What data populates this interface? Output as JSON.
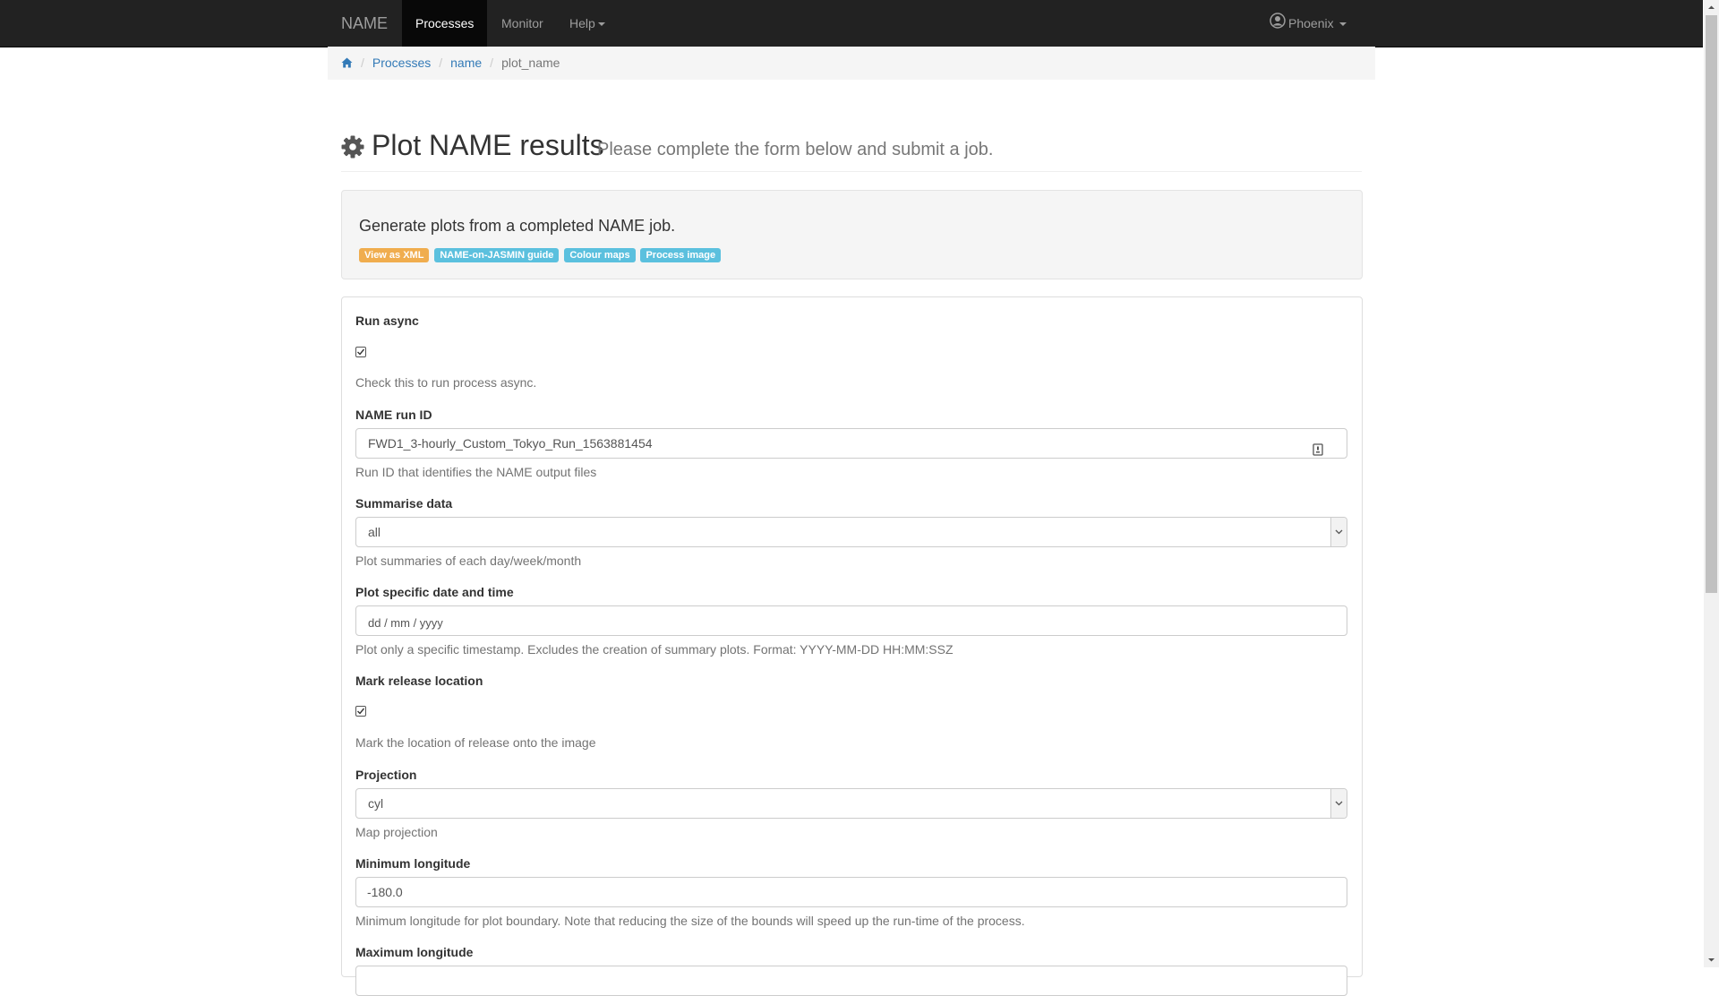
{
  "navbar": {
    "brand": "NAME",
    "items": [
      {
        "label": "Processes",
        "active": true
      },
      {
        "label": "Monitor",
        "active": false
      },
      {
        "label": "Help",
        "active": false
      }
    ],
    "user": "Phoenix"
  },
  "breadcrumb": {
    "items": [
      "Processes",
      "name",
      "plot_name"
    ]
  },
  "header": {
    "title": "Plot NAME results",
    "subtitle": "Please complete the form below and submit a job."
  },
  "well": {
    "description": "Generate plots from a completed NAME job.",
    "labels": [
      {
        "text": "View as XML",
        "color": "#f0ad4e"
      },
      {
        "text": "NAME-on-JASMIN guide",
        "color": "#5bc0de"
      },
      {
        "text": "Colour maps",
        "color": "#5bc0de"
      },
      {
        "text": "Process image",
        "color": "#5bc0de"
      }
    ]
  },
  "form": {
    "run_async": {
      "label": "Run async",
      "checked": true,
      "help": "Check this to run process async."
    },
    "run_id": {
      "label": "NAME run ID",
      "value": "FWD1_3-hourly_Custom_Tokyo_Run_1563881454",
      "help": "Run ID that identifies the NAME output files"
    },
    "summarise": {
      "label": "Summarise data",
      "value": "all",
      "help": "Plot summaries of each day/week/month"
    },
    "timestamp": {
      "label": "Plot specific date and time",
      "placeholder": "dd / mm / yyyy",
      "help": "Plot only a specific timestamp. Excludes the creation of summary plots. Format: YYYY-MM-DD HH:MM:SSZ"
    },
    "mark_release": {
      "label": "Mark release location",
      "checked": true,
      "help": "Mark the location of release onto the image"
    },
    "projection": {
      "label": "Projection",
      "value": "cyl",
      "help": "Map projection"
    },
    "min_lon": {
      "label": "Minimum longitude",
      "value": "-180.0",
      "help": "Minimum longitude for plot boundary. Note that reducing the size of the bounds will speed up the run-time of the process."
    },
    "max_lon": {
      "label": "Maximum longitude"
    }
  },
  "colors": {
    "navbar_bg": "#222222",
    "link": "#337ab7",
    "label_warning": "#f0ad4e",
    "label_info": "#5bc0de"
  }
}
